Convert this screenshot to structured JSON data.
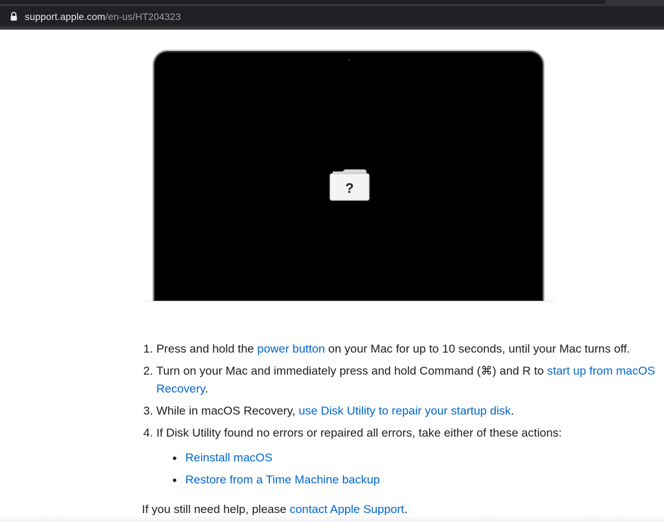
{
  "browser": {
    "url_host": "support.apple.com",
    "url_path": "/en-us/HT204323"
  },
  "hero": {
    "folder_symbol": "?"
  },
  "steps": [
    {
      "number": "1.",
      "text_before": "Press and hold the ",
      "link": "power button",
      "text_after": " on your Mac for up to 10 seconds, until your Mac turns off."
    },
    {
      "number": "2.",
      "text_before": "Turn on your Mac and immediately press and hold Command (⌘) and R to ",
      "link": "start up from macOS Recovery",
      "text_after": "."
    },
    {
      "number": "3.",
      "text_before": "While in macOS Recovery, ",
      "link": "use Disk Utility to repair your startup disk",
      "text_after": "."
    },
    {
      "number": "4.",
      "text": "If Disk Utility found no errors or repaired all errors, take either of these actions:",
      "actions": [
        "Reinstall macOS",
        "Restore from a Time Machine backup"
      ]
    }
  ],
  "help": {
    "text_before": "If you still need help, please ",
    "link": "contact Apple Support",
    "text_after": "."
  },
  "colors": {
    "link": "#0066cc",
    "text": "#1d1d1f",
    "chrome_bar": "#202124"
  }
}
